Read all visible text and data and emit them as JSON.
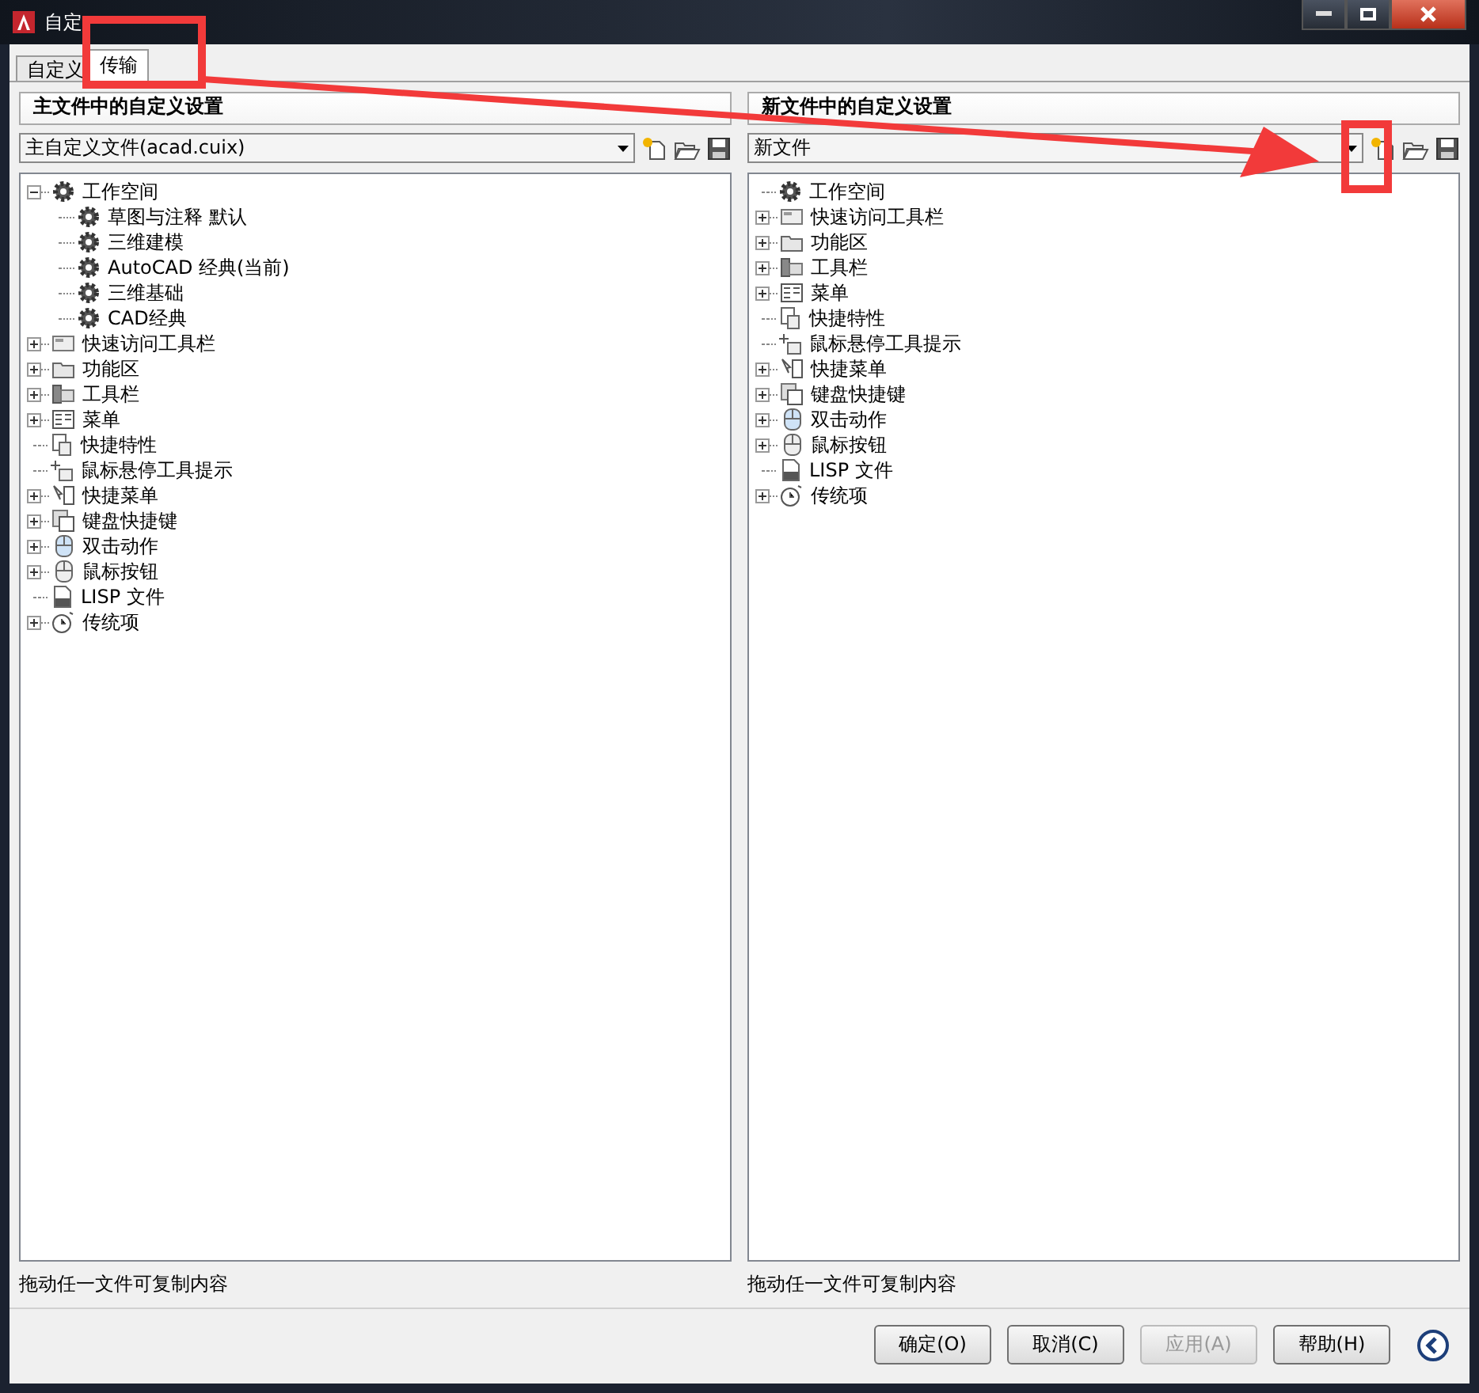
{
  "window": {
    "title": "自定"
  },
  "tabs": [
    {
      "label": "自定义",
      "selected": false
    },
    {
      "label": "传输",
      "selected": true
    }
  ],
  "panels": [
    {
      "header": "主文件中的自定义设置",
      "file": "主自定义文件(acad.cuix)",
      "status": "拖动任一文件可复制内容",
      "tree": [
        {
          "label": "工作空间",
          "kind": "workspace",
          "expanded": true,
          "children": [
            {
              "label": "草图与注释 默认",
              "kind": "gear"
            },
            {
              "label": "三维建模",
              "kind": "gear"
            },
            {
              "label": "AutoCAD 经典(当前)",
              "kind": "gear"
            },
            {
              "label": "三维基础",
              "kind": "gear"
            },
            {
              "label": "CAD经典",
              "kind": "gear"
            }
          ]
        },
        {
          "label": "快速访问工具栏",
          "kind": "toolbar",
          "expanded": false
        },
        {
          "label": "功能区",
          "kind": "folder",
          "expanded": false
        },
        {
          "label": "工具栏",
          "kind": "toolbar2",
          "expanded": false
        },
        {
          "label": "菜单",
          "kind": "menu",
          "expanded": false
        },
        {
          "label": "快捷特性",
          "kind": "props"
        },
        {
          "label": "鼠标悬停工具提示",
          "kind": "tooltip"
        },
        {
          "label": "快捷菜单",
          "kind": "shortcut",
          "expanded": false
        },
        {
          "label": "键盘快捷键",
          "kind": "keyboard",
          "expanded": false
        },
        {
          "label": "双击动作",
          "kind": "mouse2",
          "expanded": false
        },
        {
          "label": "鼠标按钮",
          "kind": "mouse",
          "expanded": false
        },
        {
          "label": "LISP 文件",
          "kind": "lisp"
        },
        {
          "label": "传统项",
          "kind": "clock",
          "expanded": false
        }
      ]
    },
    {
      "header": "新文件中的自定义设置",
      "file": "新文件",
      "status": "拖动任一文件可复制内容",
      "tree": [
        {
          "label": "工作空间",
          "kind": "workspace"
        },
        {
          "label": "快速访问工具栏",
          "kind": "toolbar",
          "expanded": false
        },
        {
          "label": "功能区",
          "kind": "folder",
          "expanded": false
        },
        {
          "label": "工具栏",
          "kind": "toolbar2",
          "expanded": false
        },
        {
          "label": "菜单",
          "kind": "menu",
          "expanded": false
        },
        {
          "label": "快捷特性",
          "kind": "props"
        },
        {
          "label": "鼠标悬停工具提示",
          "kind": "tooltip"
        },
        {
          "label": "快捷菜单",
          "kind": "shortcut",
          "expanded": false
        },
        {
          "label": "键盘快捷键",
          "kind": "keyboard",
          "expanded": false
        },
        {
          "label": "双击动作",
          "kind": "mouse2",
          "expanded": false
        },
        {
          "label": "鼠标按钮",
          "kind": "mouse",
          "expanded": false
        },
        {
          "label": "LISP 文件",
          "kind": "lisp"
        },
        {
          "label": "传统项",
          "kind": "clock",
          "expanded": false
        }
      ]
    }
  ],
  "buttons": [
    {
      "label": "确定(O)",
      "disabled": false
    },
    {
      "label": "取消(C)",
      "disabled": false
    },
    {
      "label": "应用(A)",
      "disabled": true
    },
    {
      "label": "帮助(H)",
      "disabled": false
    }
  ]
}
